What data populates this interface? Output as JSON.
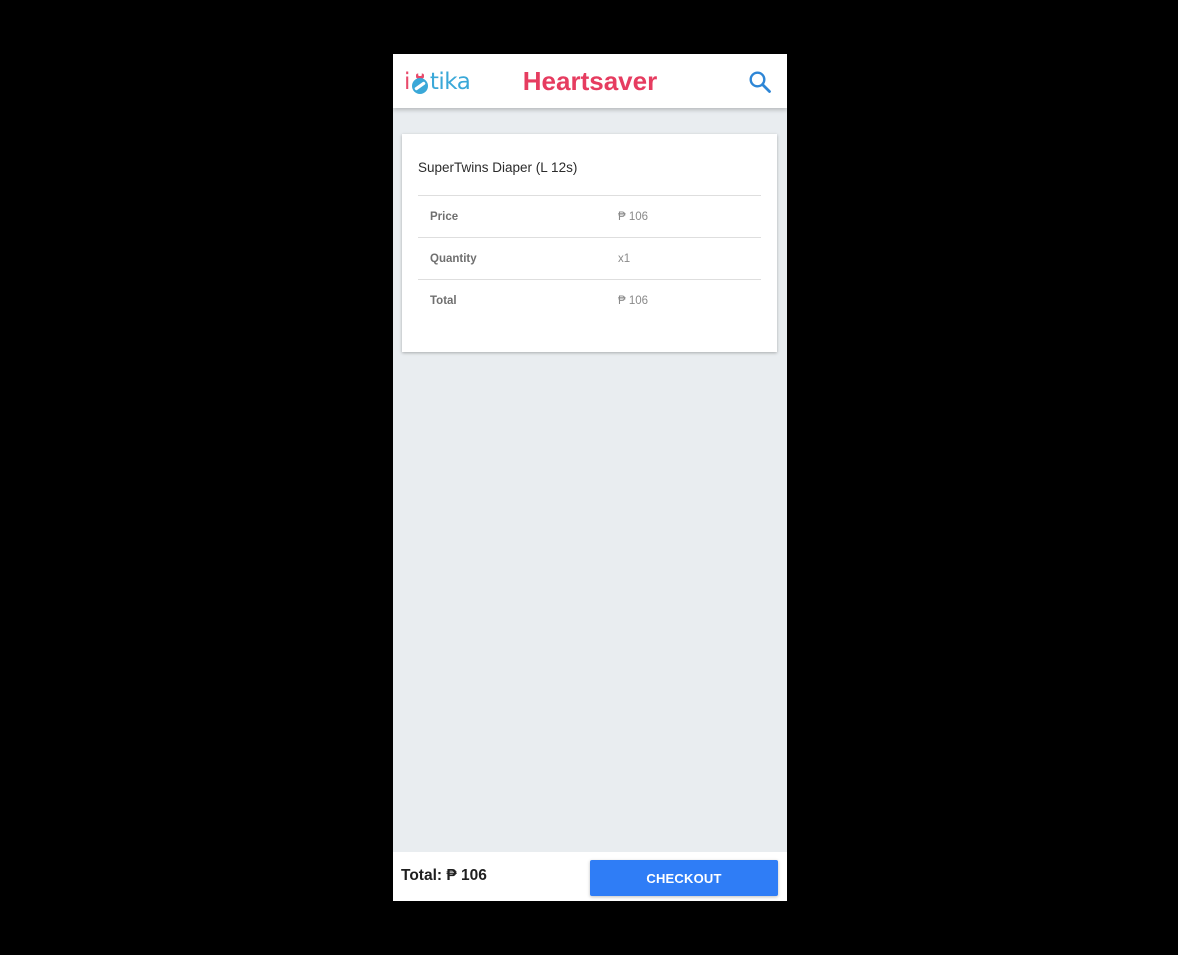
{
  "header": {
    "logo": {
      "prefix": "i",
      "middle_glyph": "pill-o-icon",
      "suffix": "tika",
      "colors": {
        "prefix": "#e84a6b",
        "suffix": "#3aa8d8",
        "glyph_pink": "#e84a6b",
        "glyph_blue": "#3aa8d8"
      }
    },
    "title": "Heartsaver",
    "search_icon": "search-icon"
  },
  "cart": {
    "items": [
      {
        "name": "SuperTwins Diaper (L 12s)",
        "rows": [
          {
            "label": "Price",
            "value": "₱ 106"
          },
          {
            "label": "Quantity",
            "value": "x1"
          },
          {
            "label": "Total",
            "value": "₱ 106"
          }
        ]
      }
    ]
  },
  "footer": {
    "total": "Total: ₱ 106",
    "checkout_label": "CHECKOUT"
  },
  "colors": {
    "title": "#e63c60",
    "accent": "#2f7df6",
    "search_icon": "#2e86d6",
    "background": "#e9edf0"
  }
}
